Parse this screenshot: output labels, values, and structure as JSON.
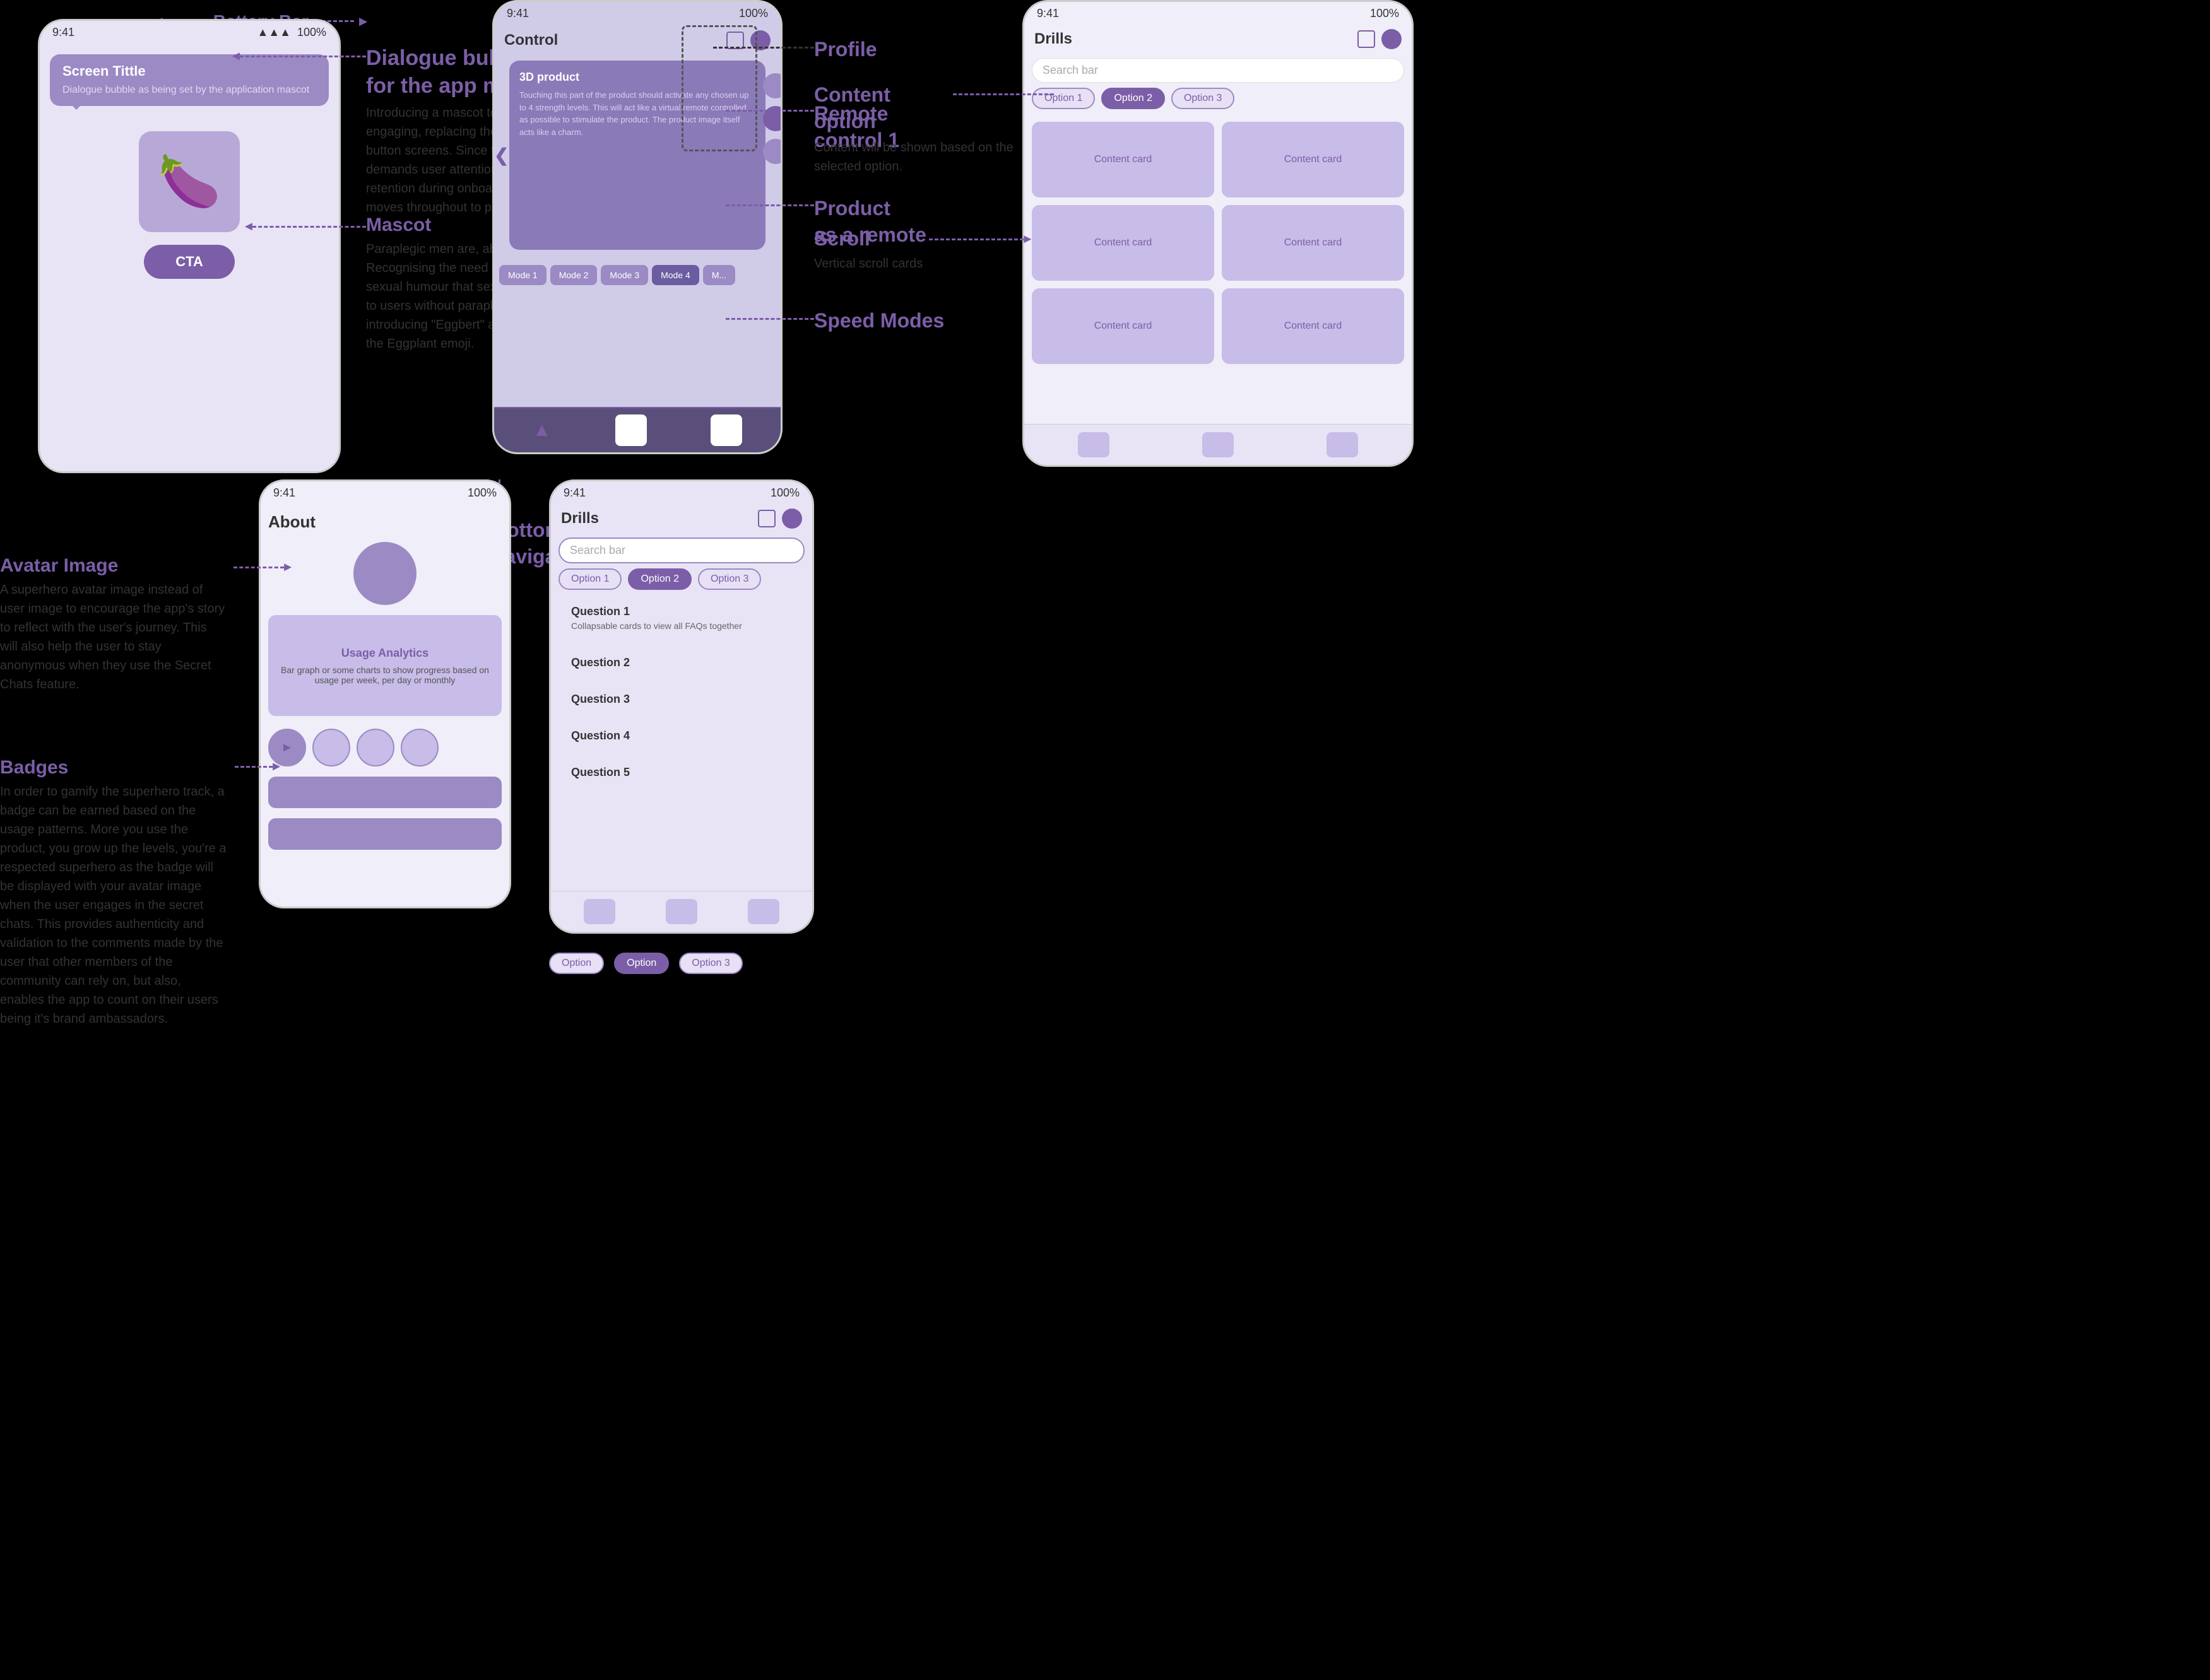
{
  "battery_bar": {
    "label": "Battery Bar"
  },
  "phone1": {
    "status": {
      "left": "9:41",
      "right": "100%"
    },
    "screen_title": {
      "title": "Screen Tittle",
      "body": "Dialogue bubble as being set by the application mascot"
    },
    "cta": "CTA"
  },
  "annotations": {
    "dialogue_bubble": {
      "title": "Dialogue bubble\nfor the app mascot",
      "body": "Introducing a mascot to make onboarding engaging, replacing the repetitive \"next\" button screens. Since the product demands user attention and information retention during onboarding, the character moves throughout to prevent monotony."
    },
    "mascot": {
      "title": "Mascot",
      "body": "Paraplegic men are, above all, individuals. Recognising the need to incorporate sexual humour that sextech products offer to users without paraplegia, we're introducing \"Eggbert\" as a playful take on the Eggplant emoji."
    },
    "avatar_image": {
      "title": "Avatar Image",
      "body": "A superhero avatar image instead of user image to encourage the app's story to reflect with the user's journey.\nThis will also help the user to stay anonymous when they use the Secret Chats feature."
    },
    "badges": {
      "title": "Badges",
      "body": "In order to gamify the superhero track, a badge can be earned based on the usage patterns. More you use the product, you grow up the levels, you're a respected superhero as the badge will be displayed with your avatar image when the user engages in the secret chats. This provides authenticity and validation to the comments made by the user that other members of the community can rely on, but also, enables the app to count on their users being it's brand ambassadors."
    },
    "profile": {
      "title": "Profile"
    },
    "remote_control_1": {
      "title": "Remote\ncontrol 1"
    },
    "product_as_remote": {
      "title": "Product\nas a remote"
    },
    "speed_modes": {
      "title": "Speed Modes"
    },
    "bottom_nav": {
      "title": "Bottom\nnavigation bar"
    },
    "content_option": {
      "title": "Content\noption",
      "body": "Content will be shown based on the selected option."
    },
    "scroll": {
      "title": "Scroll",
      "body": "Vertical scroll\ncards"
    }
  },
  "phone2": {
    "status": {
      "left": "9:41",
      "right": "100%"
    },
    "title": "Control",
    "product_card": {
      "title": "3D product",
      "body": "Touching this part of the product should activate any chosen up to 4 strength levels. This will act like a virtual remote controlled as possible to stimulate the product. The product image itself acts like a charm."
    },
    "modes": [
      "Mode 1",
      "Mode 2",
      "Mode 3",
      "Mode 4",
      "M..."
    ]
  },
  "phone3": {
    "status": {
      "left": "9:41",
      "right": "100%"
    },
    "title": "Drills",
    "search_placeholder": "Search bar",
    "options": [
      "Option 1",
      "Option 2",
      "Option 3"
    ],
    "content_cards": [
      "Content card",
      "Content card",
      "Content card",
      "Content card",
      "Content card",
      "Content card"
    ]
  },
  "phone4": {
    "status": {
      "left": "9:41",
      "right": "100%"
    },
    "title": "About",
    "usage_analytics": {
      "title": "Usage Analytics",
      "body": "Bar graph or some charts to show progress based on usage per week, per day or monthly"
    },
    "badges_count": 4
  },
  "phone5": {
    "status": {
      "left": "9:41",
      "right": "100%"
    },
    "title": "Drills",
    "search_placeholder": "Search bar",
    "options": [
      "Option 1",
      "Option 2",
      "Option 3"
    ],
    "questions": [
      {
        "title": "Question 1",
        "body": "Collapsable cards to view all FAQs together"
      },
      {
        "title": "Question 2",
        "body": ""
      },
      {
        "title": "Question 3",
        "body": ""
      },
      {
        "title": "Question 4",
        "body": ""
      },
      {
        "title": "Question 5",
        "body": ""
      }
    ]
  },
  "phone5_bottom_options": [
    "Option",
    "Option",
    "Option 3"
  ]
}
